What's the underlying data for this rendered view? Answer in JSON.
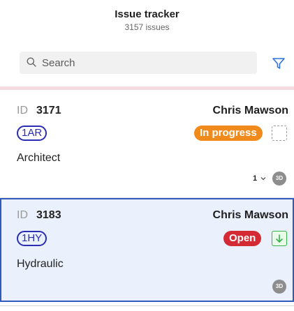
{
  "header": {
    "title": "Issue tracker",
    "subtitle": "3157 issues"
  },
  "search": {
    "placeholder": "Search",
    "icon": "search-icon",
    "filter_icon": "filter-icon"
  },
  "issues": [
    {
      "id_label": "ID",
      "id": "3171",
      "assignee": "Chris Mawson",
      "code": "1AR",
      "discipline": "Architect",
      "status": "In progress",
      "status_color": "#f08a1c",
      "action_icon": "dashed-square-icon",
      "count": "1",
      "badge": "3D",
      "selected": false
    },
    {
      "id_label": "ID",
      "id": "3183",
      "assignee": "Chris Mawson",
      "code": "1HY",
      "discipline": "Hydraulic",
      "status": "Open",
      "status_color": "#d42a34",
      "action_icon": "arrow-down-icon",
      "badge": "3D",
      "selected": true
    }
  ],
  "colors": {
    "accent": "#2f5bbf",
    "selected_bg": "#eaf1fd",
    "code_pill": "#2b2bb3",
    "download_green": "#33b34a"
  }
}
